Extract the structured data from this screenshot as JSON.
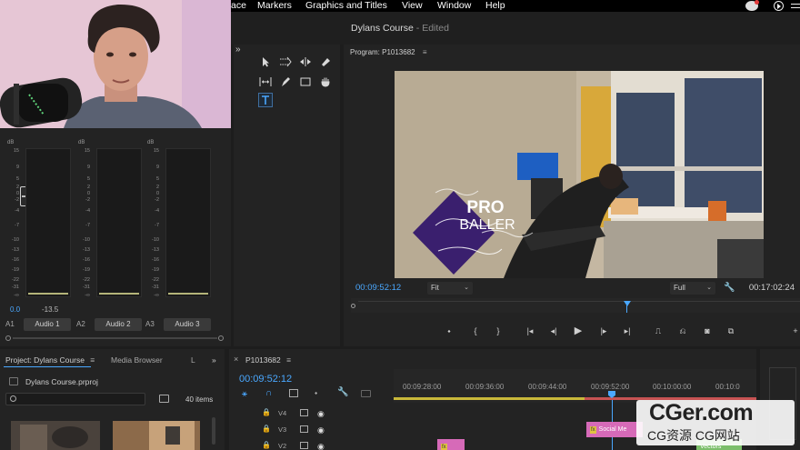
{
  "menu": {
    "items": [
      "ace",
      "Markers",
      "Graphics and Titles",
      "View",
      "Window",
      "Help"
    ]
  },
  "window": {
    "title": "Dylans Course",
    "status": " - Edited"
  },
  "audio_mixer": {
    "db_label": "dB",
    "scale": [
      "15",
      "9",
      "5",
      "2",
      "0",
      "-2",
      "-4",
      "-7",
      "-10",
      "-13",
      "-16",
      "-19",
      "-22",
      "-25",
      "-31",
      "-37",
      "-∞"
    ],
    "pan_values": [
      "0.0",
      "-13.5"
    ],
    "channels": [
      {
        "id": "A1",
        "name": "Audio 1"
      },
      {
        "id": "A2",
        "name": "Audio 2"
      },
      {
        "id": "A3",
        "name": "Audio 3"
      }
    ]
  },
  "program": {
    "tab": "Program: P1013682",
    "timecode_current": "00:09:52:12",
    "fit": "Fit",
    "resolution": "Full",
    "timecode_duration": "00:17:02:24",
    "title_overlay": {
      "line1": "PRO",
      "line2": "BALLER"
    }
  },
  "project": {
    "tab": "Project: Dylans Course",
    "media_browser": "Media Browser",
    "third_tab": "L",
    "file": "Dylans Course.prproj",
    "items_count": "40 items"
  },
  "timeline": {
    "tab": "P1013682",
    "timecode": "00:09:52:12",
    "ruler": [
      "00:09:28:00",
      "00:09:36:00",
      "00:09:44:00",
      "00:09:52:00",
      "00:10:00:00",
      "00:10:0"
    ],
    "tracks": [
      "V4",
      "V3",
      "V2"
    ],
    "clips": {
      "v3": "Social Me",
      "v2_right": "Vectors"
    }
  },
  "watermark": {
    "main": "CGer.com",
    "sub": "CG资源 CG网站"
  },
  "colors": {
    "accent_blue": "#4aa8ff",
    "clip_pink": "#d66ab8",
    "playhead": "#4aa8ff"
  }
}
